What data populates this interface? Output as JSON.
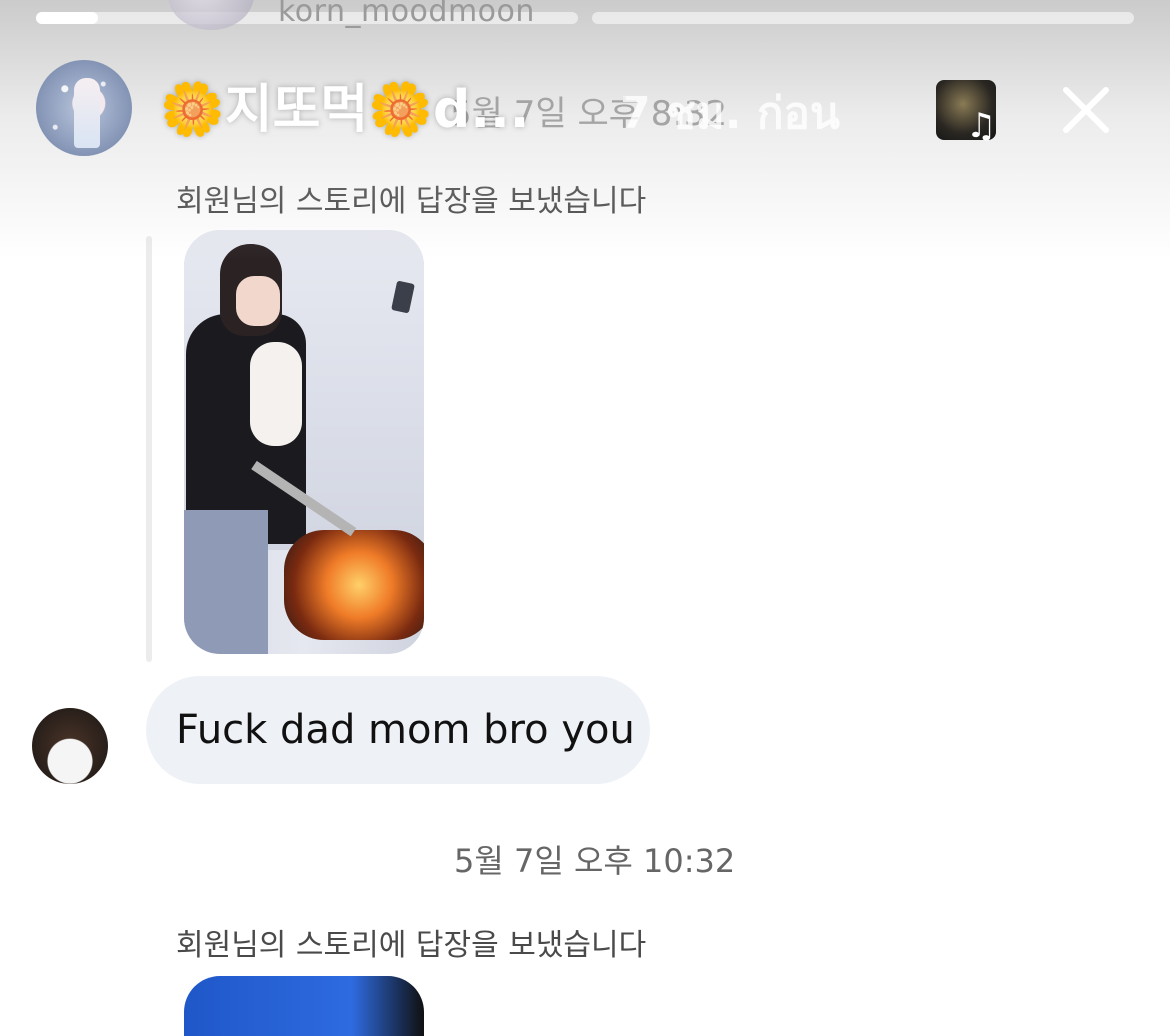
{
  "background_story": {
    "username": "korn_moodmoon"
  },
  "header": {
    "name": "🌼지또먹🌼d...",
    "time_ago": "7 ชม. ก่อน",
    "close_icon": "close-icon",
    "music_icon": "music-note-icon"
  },
  "chat": {
    "timestamp_hidden": "5월 7일 오후 8:32",
    "reply_label_1": "회원님의 스토리에 답장을 보냈습니다",
    "message_text": "Fuck dad mom bro you",
    "timestamp_2": "5월 7일 오후 10:32",
    "reply_label_2": "회원님의 스토리에 답장을 보냈습니다"
  },
  "colors": {
    "bubble_bg": "#eef1f6",
    "meta_text": "#666666"
  }
}
